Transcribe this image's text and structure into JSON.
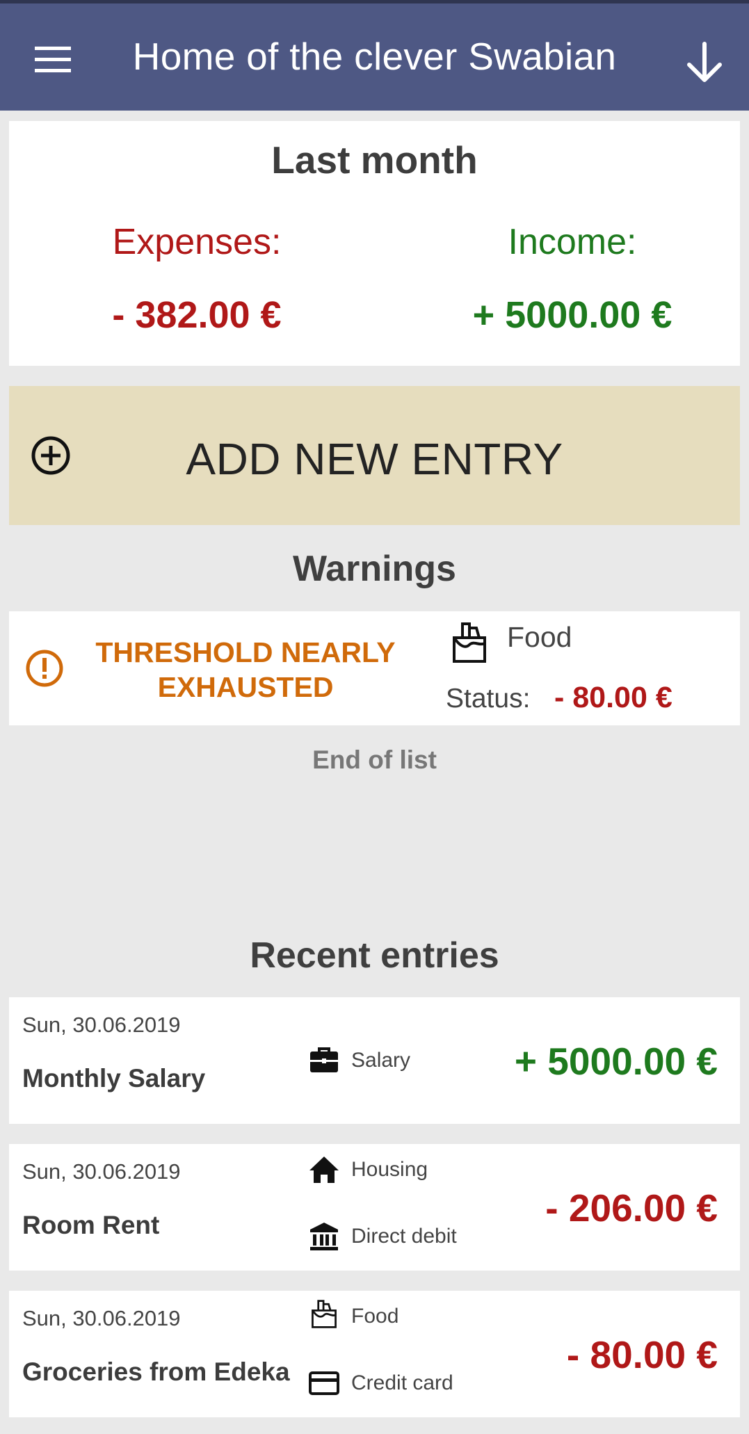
{
  "app_bar": {
    "title": "Home of the clever Swabian",
    "menu_icon": "hamburger-menu-icon",
    "action_icon": "arrow-down-icon"
  },
  "summary": {
    "heading": "Last month",
    "expenses_label": "Expenses:",
    "expenses_value": "- 382.00 €",
    "income_label": "Income:",
    "income_value": "+ 5000.00 €"
  },
  "add_entry": {
    "label": "ADD NEW ENTRY",
    "icon": "add-circle-icon"
  },
  "warnings": {
    "title": "Warnings",
    "items": [
      {
        "message": "THRESHOLD NEARLY EXHAUSTED",
        "category": "Food",
        "status_label": "Status:",
        "status_value": "- 80.00 €"
      }
    ],
    "end_text": "End of list"
  },
  "recent": {
    "title": "Recent entries",
    "entries": [
      {
        "date": "Sun, 30.06.2019",
        "name": "Monthly Salary",
        "category": "Salary",
        "payment": "",
        "amount": "+ 5000.00 €"
      },
      {
        "date": "Sun, 30.06.2019",
        "name": "Room Rent",
        "category": "Housing",
        "payment": "Direct debit",
        "amount": "- 206.00 €"
      },
      {
        "date": "Sun, 30.06.2019",
        "name": "Groceries from Edeka",
        "category": "Food",
        "payment": "Credit card",
        "amount": "- 80.00 €"
      }
    ]
  },
  "colors": {
    "app_bar": "#4e5884",
    "expense": "#b01818",
    "income": "#1e7a1e",
    "warning": "#d06a0a",
    "add_button": "#e6ddbe"
  }
}
